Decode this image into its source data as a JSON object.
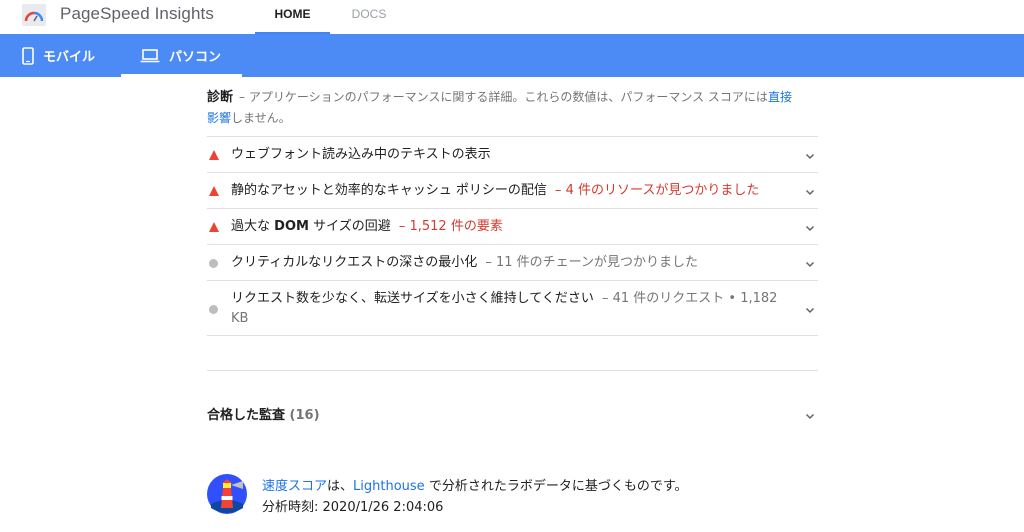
{
  "app": {
    "title": "PageSpeed Insights",
    "logo_icon": "pagespeed-gauge-icon"
  },
  "topnav": {
    "home_label": "HOME",
    "docs_label": "DOCS",
    "active": "HOME"
  },
  "device_tabs": {
    "mobile_label": "モバイル",
    "desktop_label": "パソコン",
    "active": "パソコン"
  },
  "diagnostics": {
    "title": "診断",
    "description_prefix": "– アプリケーションのパフォーマンスに関する詳細。これらの数値は、パフォーマンス スコアには",
    "link_text_1": "直接",
    "link_text_2": "影響",
    "description_suffix": "しません。"
  },
  "audits": [
    {
      "status": "fail",
      "title": "ウェブフォント読み込み中のテキストの表示",
      "detail": ""
    },
    {
      "status": "fail",
      "title": "静的なアセットと効率的なキャッシュ ポリシーの配信",
      "detail": "– 4 件のリソースが見つかりました"
    },
    {
      "status": "fail",
      "title_pre": "過大な",
      "title_strong": "DOM",
      "title_post": "サイズの回避",
      "detail": "– 1,512 件の要素"
    },
    {
      "status": "info",
      "title": "クリティカルなリクエストの深さの最小化",
      "detail": "– 11 件のチェーンが見つかりました"
    },
    {
      "status": "info",
      "title": "リクエスト数を少なく、転送サイズを小さく維持してください",
      "detail_line1": "– 41 件のリクエスト • 1,182",
      "detail_line2": "KB"
    }
  ],
  "passed_audits": {
    "title": "合格した監査",
    "count": "(16)"
  },
  "footer": {
    "link_speed_score": "速度スコア",
    "text_wa": "は、",
    "link_lighthouse": "Lighthouse",
    "text_rest": "で分析されたラボデータに基づくものです。",
    "analysis_time": "分析時刻: 2020/1/26 2:04:06"
  },
  "colors": {
    "accent_blue": "#4c8bf5",
    "fail_red": "#eb4335",
    "link_blue": "#1a73e8",
    "info_grey": "#bdbdbd"
  }
}
